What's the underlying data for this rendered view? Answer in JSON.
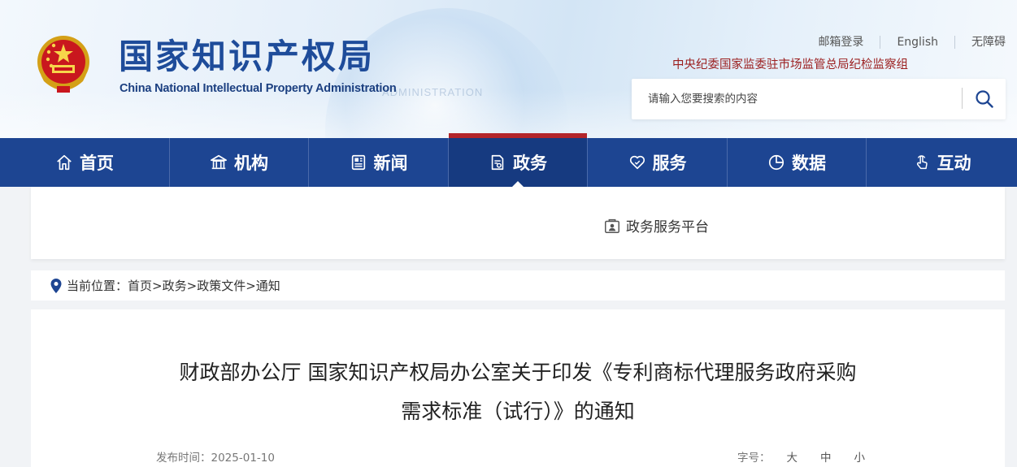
{
  "header": {
    "site_title": "国家知识产权局",
    "site_subtitle": "China National Intellectual Property Administration",
    "top_links": [
      "邮箱登录",
      "English",
      "无障碍"
    ],
    "supervisor_text": "中央纪委国家监委驻市场监管总局纪检监察组",
    "search_placeholder": "请输入您要搜索的内容",
    "search_icon": "search-icon"
  },
  "nav": {
    "items": [
      {
        "label": "首页",
        "icon": "home-icon"
      },
      {
        "label": "机构",
        "icon": "institution-icon"
      },
      {
        "label": "新闻",
        "icon": "news-icon"
      },
      {
        "label": "政务",
        "icon": "government-affairs-icon",
        "active": true
      },
      {
        "label": "服务",
        "icon": "service-icon"
      },
      {
        "label": "数据",
        "icon": "data-pie-icon"
      },
      {
        "label": "互动",
        "icon": "interaction-icon"
      }
    ],
    "active_color": "#b3252a",
    "bar_color": "#1d4592"
  },
  "subpanel": {
    "link_label": "政务服务平台",
    "link_icon": "service-platform-icon"
  },
  "breadcrumb": {
    "prefix": "当前位置：",
    "items": [
      "首页",
      "政务",
      "政策文件",
      "通知"
    ],
    "separator": ">"
  },
  "article": {
    "title_line1": "财政部办公厅 国家知识产权局办公室关于印发《专利商标代理服务政府采购",
    "title_line2": "需求标准（试行）》的通知",
    "publish_date": "发布时间：2025-01-10",
    "font_size_label": "字号：",
    "font_size_options": [
      "大",
      "中",
      "小"
    ]
  }
}
